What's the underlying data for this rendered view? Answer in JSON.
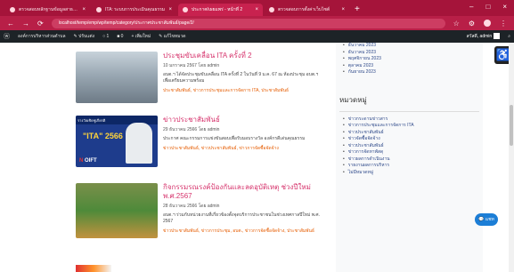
{
  "browser": {
    "tabs": [
      {
        "label": "ตรวจสอบหลักฐานข้อมูลสาธารณะ",
        "active": false
      },
      {
        "label": "ITA: ระบบการประเมินคุณธรรม",
        "active": false
      },
      {
        "label": "ประกาศ/เผยแพร่ - หน้าที่ 2",
        "active": true
      },
      {
        "label": "ตรวจสอบการตั้งค่าเว็บไซต์",
        "active": false
      }
    ],
    "new_tab": "+",
    "window_controls": [
      "–",
      "□",
      "×"
    ],
    "url": "localhost/temp/emp/wp/temp/category/ประกาศประชาสัมพันธ์/page/2/",
    "nav": {
      "back": "←",
      "forward": "→",
      "reload": "⟳"
    },
    "right_icons": {
      "star": "☆",
      "extension": "⚙",
      "menu": "⋮"
    }
  },
  "adminbar": {
    "wp_logo": "ⓦ",
    "site": "องค์การบริหารส่วนตำบล",
    "customize": "✎ ปรับแต่ง",
    "comments": "○ 1",
    "updates": "■ 0",
    "new": "+ เพิ่มใหม่",
    "edit": "✎ แก้ไขหมวด",
    "greeting": "สวัสดี, admin"
  },
  "posts": [
    {
      "title": "ประชุมขับเคลื่อน ITA ครั้งที่ 2",
      "date": "10 มกราคม 2567 โดย admin",
      "excerpt": "อบต.ฯ ได้จัดประชุมขับเคลื่อน ITA ครั้งที่ 2 ในวันที่ 9 ม.ค. 67 ณ ห้องประชุม อบต.ฯ เพื่อเตรียมความพร้อม",
      "cats": "ประชาสัมพันธ์, ข่าวการประชุมและการจัดการ ITA, ประชาสัมพันธ์"
    },
    {
      "title": "ข่าวประชาสัมพันธ์",
      "date": "29 ธันวาคม 2566 โดย admin",
      "excerpt": "ประกาศ คณะกรรมการแข่งขันสอบเพื่อรับมอบรางวัล องค์กรดีเด่นคุณธรรม",
      "cats": "ข่าวประชาสัมพันธ์, ข่าวประชาสัมพันธ์, ข่าวการจัดซื้อจัดจ้าง"
    },
    {
      "title": "กิจกรรมรณรงค์ป้องกันและลดอุบัติเหตุ ช่วงปีใหม่ พ.ศ.2567",
      "date": "28 ธันวาคม 2566 โดย admin",
      "excerpt": "อบต.ฯ ร่วมกับหน่วยงานที่เกี่ยวข้องตั้งจุดบริการประชาชนในช่วงเทศกาลปีใหม่ พ.ศ. 2567",
      "cats": "ข่าวประชาสัมพันธ์, ข่าวการประชุม, อบต., ข่าวการจัดซื้อจัดจ้าง, ประชาสัมพันธ์"
    }
  ],
  "thumb2": {
    "band": "รางวัลเชิดชูเกียรติ",
    "big": "\"ITA\" 2566",
    "logo_brand": "N",
    "logo_rest": " OIFT"
  },
  "sidebar": {
    "archives": [
      "ธันวาคม 2023",
      "ธันวาคม 2023",
      "พฤศจิกายน 2023",
      "ตุลาคม 2023",
      "กันยายน 2023"
    ],
    "categories_heading": "หมวดหมู่",
    "categories": [
      "ข่าวกระดานข่าวสาร",
      "ข่าวการประชุมและการจัดการ ITA",
      "ข่าวประชาสัมพันธ์",
      "ข่าวจัดซื้อจัดจ้าง",
      "ข่าวประชาสัมพันธ์",
      "ข่าวการจัดหาพัสดุ",
      "ข่าวผลการดำเนินงาน",
      "รายงานผลการบริหาร",
      "ไม่มีหมวดหมู่"
    ]
  },
  "accessibility_icon": "♿",
  "chat_label": "💬 แชท"
}
